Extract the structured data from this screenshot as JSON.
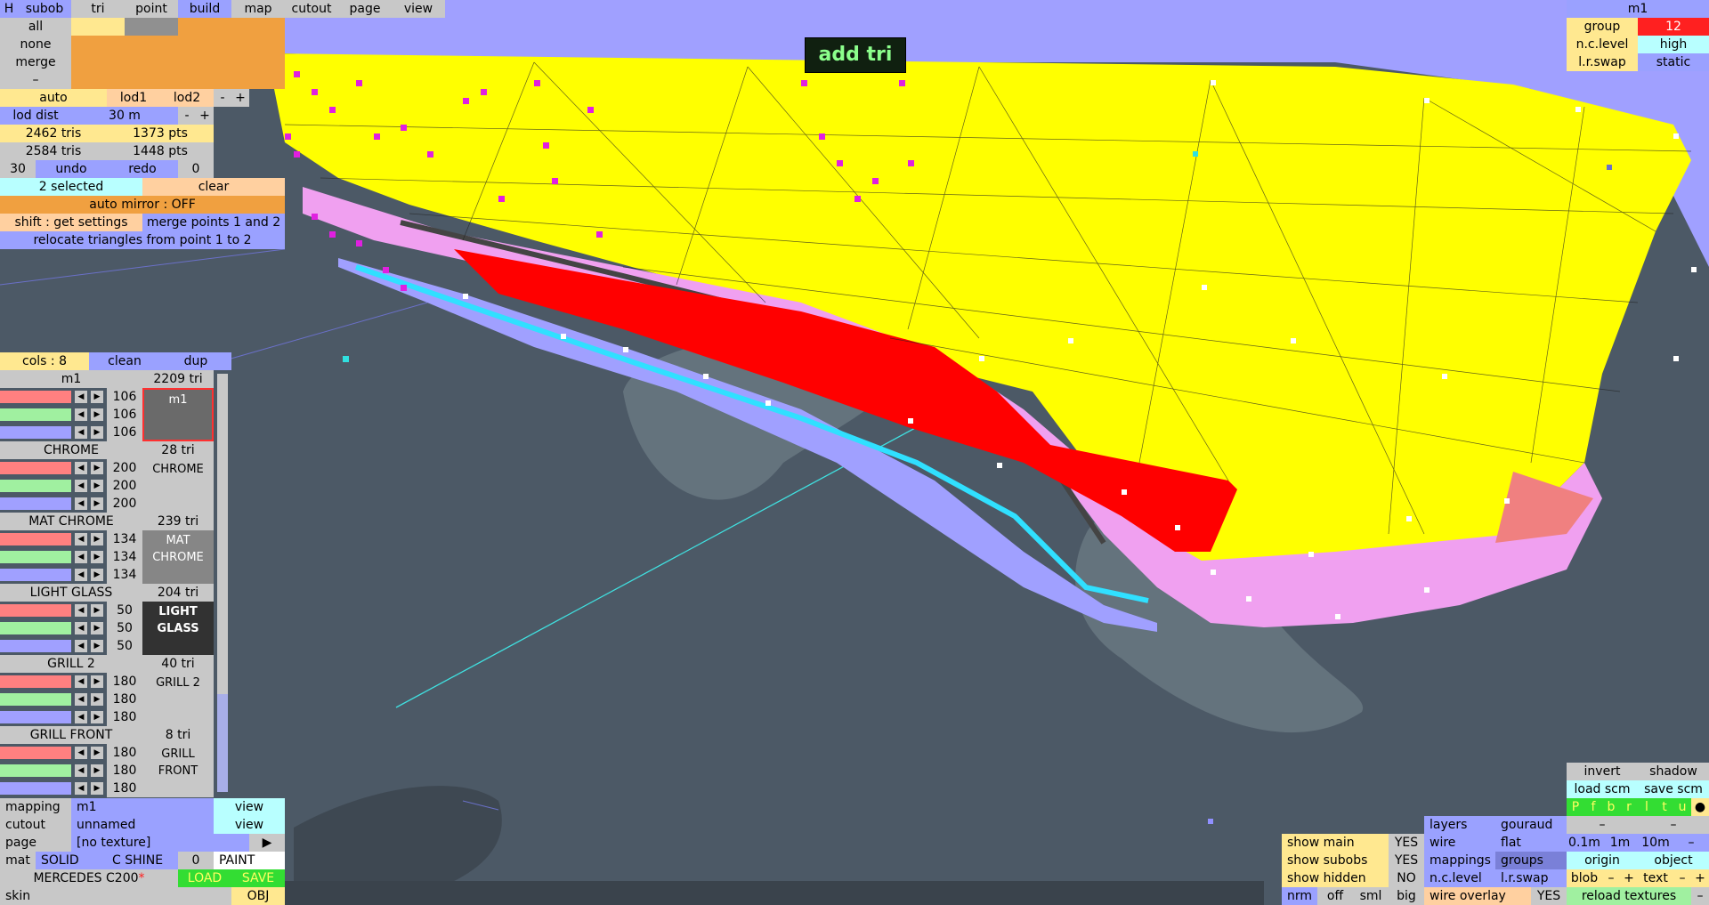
{
  "hud": {
    "message": "add tri"
  },
  "tabs": [
    {
      "label": "H"
    },
    {
      "label": "subob"
    },
    {
      "label": "tri"
    },
    {
      "label": "point"
    },
    {
      "label": "build"
    },
    {
      "label": "map"
    },
    {
      "label": "cutout"
    },
    {
      "label": "page"
    },
    {
      "label": "view"
    }
  ],
  "selection": {
    "all": "all",
    "none": "none",
    "merge": "merge",
    "dash": "–"
  },
  "lod": {
    "auto": "auto",
    "lod1": "lod1",
    "lod2": "lod2",
    "minus": "-",
    "plus": "+",
    "dist_label": "lod dist",
    "dist_value": "30 m"
  },
  "stats": {
    "tris1": "2462 tris",
    "pts1": "1373 pts",
    "tris2": "2584 tris",
    "pts2": "1448 pts",
    "undo_count": "30",
    "undo": "undo",
    "redo": "redo",
    "redo_count": "0"
  },
  "actions": {
    "selected": "2 selected",
    "clear": "clear",
    "auto_mirror": "auto mirror : OFF",
    "get_settings": "shift : get settings",
    "merge_points": "merge points 1 and 2",
    "relocate": "relocate triangles from point 1 to 2"
  },
  "colors_panel": {
    "cols": "cols : 8",
    "clean": "clean",
    "dup": "dup"
  },
  "materials": [
    {
      "name": "m1",
      "count": "2209 tri",
      "r": "106",
      "g": "106",
      "b": "106",
      "preview": "m1"
    },
    {
      "name": "CHROME",
      "count": "28 tri",
      "r": "200",
      "g": "200",
      "b": "200",
      "preview": "CHROME"
    },
    {
      "name": "MAT CHROME",
      "count": "239 tri",
      "r": "134",
      "g": "134",
      "b": "134",
      "preview": "MAT CHROME"
    },
    {
      "name": "LIGHT GLASS",
      "count": "204 tri",
      "r": "50",
      "g": "50",
      "b": "50",
      "preview": "LIGHT GLASS"
    },
    {
      "name": "GRILL 2",
      "count": "40 tri",
      "r": "180",
      "g": "180",
      "b": "180",
      "preview": "GRILL 2"
    },
    {
      "name": "GRILL FRONT",
      "count": "8 tri",
      "r": "180",
      "g": "180",
      "b": "180",
      "preview": "GRILL FRONT"
    }
  ],
  "bottom_left": {
    "mapping_label": "mapping",
    "mapping_value": "m1",
    "mapping_view": "view",
    "cutout_label": "cutout",
    "cutout_value": "unnamed",
    "cutout_view": "view",
    "page_label": "page",
    "page_value": "[no texture]",
    "page_arrow": "▶",
    "mat": "mat",
    "solid": "SOLID",
    "c_shine": "C SHINE",
    "shine_value": "0",
    "paint": "PAINT",
    "model_name": "MERCEDES C200",
    "modified_mark": "*",
    "load": "LOAD",
    "save": "SAVE",
    "skin": "skin",
    "obj": "OBJ"
  },
  "top_right": {
    "title": "m1",
    "group_label": "group",
    "group_value": "12",
    "nc_label": "n.c.level",
    "nc_value": "high",
    "lr_label": "l.r.swap",
    "lr_value": "static"
  },
  "bottom_right": {
    "invert": "invert",
    "shadow": "shadow",
    "load_scm": "load scm",
    "save_scm": "save scm",
    "axis_buttons": [
      "P",
      "f",
      "b",
      "r",
      "l",
      "t",
      "u",
      "●"
    ],
    "dash1": "–",
    "dash2": "–",
    "grid_01": "0.1m",
    "grid_1": "1m",
    "grid_10": "10m",
    "grid_minus": "–",
    "origin": "origin",
    "object": "object",
    "blob": "blob",
    "blob_minus": "–",
    "blob_plus": "+",
    "text": "text",
    "text_minus": "–",
    "text_plus": "+",
    "reload": "reload textures",
    "reload_minus": "–"
  },
  "view_options": {
    "show_main": "show main",
    "show_main_val": "YES",
    "show_subobs": "show subobs",
    "show_subobs_val": "YES",
    "show_hidden": "show hidden",
    "show_hidden_val": "NO",
    "nrm": "nrm",
    "off": "off",
    "sml": "sml",
    "big": "big",
    "layers": "layers",
    "gouraud": "gouraud",
    "wire": "wire",
    "flat": "flat",
    "mappings": "mappings",
    "groups": "groups",
    "nc_level": "n.c.level",
    "lr_swap": "l.r.swap",
    "wire_overlay": "wire overlay",
    "wire_overlay_val": "YES"
  },
  "colors": {
    "panel_blue": "#9aa1ff",
    "panel_orange": "#f0a040",
    "mesh_yellow": "#ffff00",
    "mesh_red": "#ff0000",
    "mesh_pink": "#f0a0f0",
    "mesh_lavender": "#a0a0ff",
    "background": "#4c5966",
    "selection_magenta": "#e020e0",
    "edge_cyan": "#30e0ff"
  }
}
